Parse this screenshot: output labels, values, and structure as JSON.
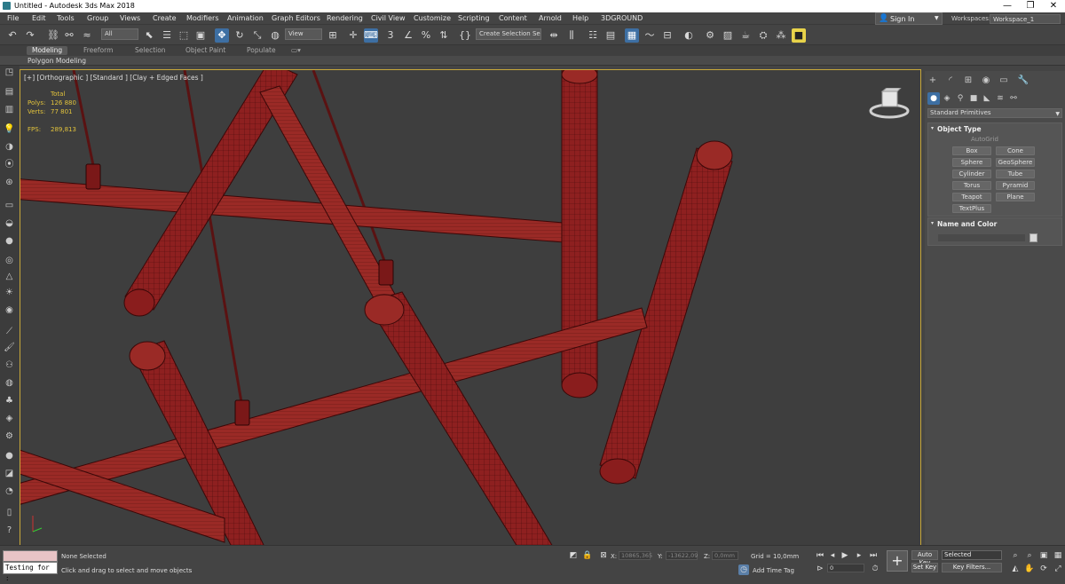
{
  "app": {
    "title": "Untitled - Autodesk 3ds Max 2018"
  },
  "window_controls": {
    "minimize": "—",
    "maximize": "❐",
    "close": "✕"
  },
  "menu": [
    "File",
    "Edit",
    "Tools",
    "Group",
    "Views",
    "Create",
    "Modifiers",
    "Animation",
    "Graph Editors",
    "Rendering",
    "Civil View",
    "Customize",
    "Scripting",
    "Content",
    "Arnold",
    "Help",
    "3DGROUND"
  ],
  "account": {
    "signin": "Sign In"
  },
  "workspaces": {
    "label": "Workspaces:",
    "value": "Workspace_1"
  },
  "toolbar": {
    "filter": "All",
    "ref_coord": "View",
    "angle_snap": "3",
    "named_sel": "Create Selection Se"
  },
  "ribbon": {
    "tabs": [
      "Modeling",
      "Freeform",
      "Selection",
      "Object Paint",
      "Populate"
    ],
    "active": "Modeling",
    "panel": "Polygon Modeling"
  },
  "viewport": {
    "label": "[+] [Orthographic ] [Standard ] [Clay + Edged Faces ]",
    "stats": {
      "total": "Total",
      "polys_label": "Polys:",
      "polys": "126 880",
      "verts_label": "Verts:",
      "verts": "77 801",
      "fps_label": "FPS:",
      "fps": "289,813"
    }
  },
  "command_panel": {
    "category": "Standard Primitives",
    "object_type": {
      "header": "Object Type",
      "autogrid": "AutoGrid",
      "buttons": [
        "Box",
        "Cone",
        "Sphere",
        "GeoSphere",
        "Cylinder",
        "Tube",
        "Torus",
        "Pyramid",
        "Teapot",
        "Plane",
        "TextPlus"
      ]
    },
    "name_color": {
      "header": "Name and Color"
    }
  },
  "status": {
    "maxscript": "Testing for :",
    "selected": "None Selected",
    "prompt": "Click and drag to select and move objects",
    "x_label": "X:",
    "x": "10865,365",
    "y_label": "Y:",
    "y": "-13622,09",
    "z_label": "Z:",
    "z": "0,0mm",
    "grid": "Grid = 10,0mm",
    "add_time_tag": "Add Time Tag",
    "frame": "0",
    "auto_key": "Auto Key",
    "set_key": "Set Key",
    "key_mode": "Selected",
    "key_filters": "Key Filters..."
  },
  "colors": {
    "model": "#8a1d1d",
    "accent": "#3d6fa3",
    "viewport_bg": "#3e3e3e",
    "stat_text": "#e2c33c"
  }
}
